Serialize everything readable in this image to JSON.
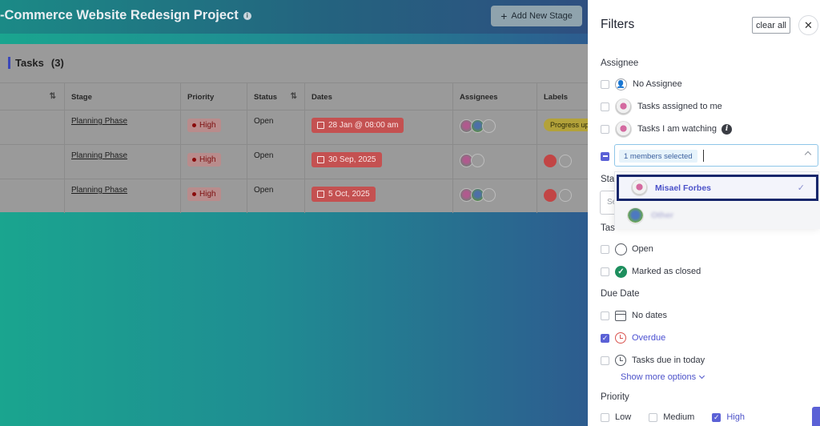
{
  "project": {
    "title": "-Commerce Website Redesign Project",
    "add_stage_label": "Add New Stage"
  },
  "tasks": {
    "heading": "Tasks",
    "count": "(3)"
  },
  "table": {
    "headers": [
      "Stage",
      "Priority",
      "Status",
      "Dates",
      "Assignees",
      "Labels"
    ],
    "rows": [
      {
        "stage": "Planning Phase",
        "priority": "High",
        "status": "Open",
        "date": "28 Jan @ 08:00 am",
        "label": "Progress up"
      },
      {
        "stage": "Planning Phase",
        "priority": "High",
        "status": "Open",
        "date": "30 Sep, 2025",
        "label": ""
      },
      {
        "stage": "Planning Phase",
        "priority": "High",
        "status": "Open",
        "date": "5 Oct, 2025",
        "label": ""
      }
    ]
  },
  "filters": {
    "title": "Filters",
    "clear_all": "clear all",
    "assignee": {
      "title": "Assignee",
      "options": [
        "No Assignee",
        "Tasks assigned to me",
        "Tasks I am watching"
      ],
      "members_chip": "1 members selected",
      "dropdown": {
        "selected_name": "Misael Forbes",
        "other_name": "Other"
      }
    },
    "stage_stub": "Sta",
    "stage_input_stub": "Se",
    "task_status": {
      "title_stub": "Tas",
      "options": [
        "Open",
        "Marked as closed"
      ]
    },
    "due_date": {
      "title": "Due Date",
      "options": [
        "No dates",
        "Overdue",
        "Tasks due in today"
      ],
      "show_more": "Show more options"
    },
    "priority": {
      "title": "Priority",
      "options": [
        "Low",
        "Medium",
        "High"
      ]
    },
    "colors": {
      "accent": "#5b61d6",
      "selected_border": "#16266b",
      "overdue": "#4a4fd1",
      "high_pill": "#8a0b0b"
    }
  }
}
